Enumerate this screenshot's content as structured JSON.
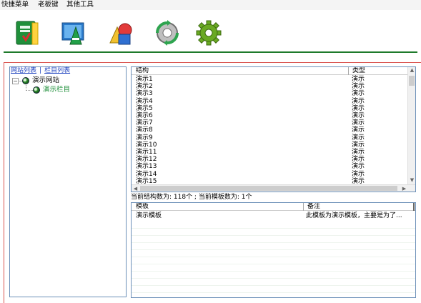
{
  "menu": [
    "快捷菜单",
    "老板键",
    "其他工具"
  ],
  "toolbar": {
    "tools": [
      {
        "icon": "green-book-icon"
      },
      {
        "icon": "letter-a-icon"
      },
      {
        "icon": "shapes-icon"
      },
      {
        "icon": "gear-refresh-icon"
      },
      {
        "icon": "gear-icon"
      }
    ]
  },
  "left_panel": {
    "tab_sites": "网站列表",
    "tab_separator": "|",
    "tab_columns": "栏目列表",
    "expander": "−",
    "tree": {
      "root": {
        "label": "演示网站",
        "icon": "globe-icon"
      },
      "child": {
        "label": "演示栏目",
        "icon": "globe-icon"
      }
    }
  },
  "structure_grid": {
    "columns": [
      "结构",
      "类型"
    ],
    "rows": [
      [
        "演示1",
        "演示"
      ],
      [
        "演示2",
        "演示"
      ],
      [
        "演示3",
        "演示"
      ],
      [
        "演示4",
        "演示"
      ],
      [
        "演示5",
        "演示"
      ],
      [
        "演示6",
        "演示"
      ],
      [
        "演示7",
        "演示"
      ],
      [
        "演示8",
        "演示"
      ],
      [
        "演示9",
        "演示"
      ],
      [
        "演示10",
        "演示"
      ],
      [
        "演示11",
        "演示"
      ],
      [
        "演示12",
        "演示"
      ],
      [
        "演示13",
        "演示"
      ],
      [
        "演示14",
        "演示"
      ],
      [
        "演示15",
        "演示"
      ]
    ]
  },
  "status": "当前结构数为: 118个 ;  当前模板数为: 1个",
  "template_grid": {
    "columns": [
      "模板",
      "备注"
    ],
    "rows": [
      [
        "演示模板",
        "此模板为演示模板，主要是为了..."
      ]
    ]
  },
  "colors": {
    "accent_green": "#1e7a2b",
    "link_blue": "#1a3fbf",
    "frame_red": "#d9534f",
    "panel_border": "#6b8fb8"
  }
}
